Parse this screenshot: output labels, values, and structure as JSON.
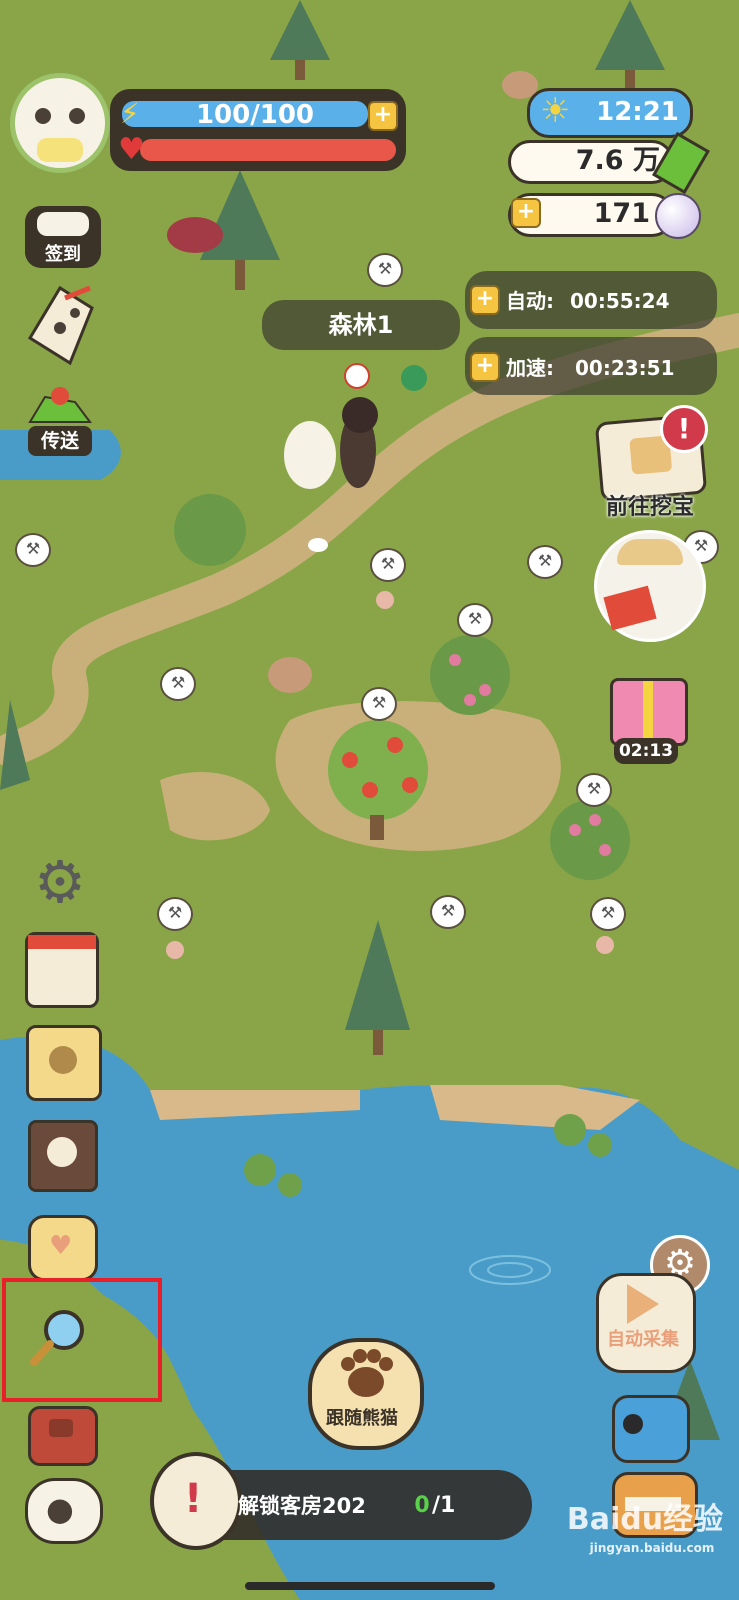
{
  "hud": {
    "energy": "100/100",
    "time": "12:21",
    "coins": "7.6 万",
    "pearls": "171"
  },
  "timers": {
    "auto_label": "自动:",
    "auto_time": "00:55:24",
    "speed_label": "加速:",
    "speed_time": "00:23:51"
  },
  "location": "森林1",
  "left_menu": {
    "signin": "签到",
    "teleport": "传送"
  },
  "right_menu": {
    "treasure": "前往挖宝",
    "gift_timer": "02:13",
    "auto_collect": "自动采集"
  },
  "bottom": {
    "follow": "跟随熊猫",
    "unlock_label": "解锁客房202",
    "progress_current": "0",
    "progress_total": "/1"
  },
  "watermark": "Baidu经验",
  "watermark_sub": "jingyan.baidu.com",
  "colors": {
    "grass": "#8aa547",
    "water": "#4a9cc8",
    "path": "#c9b07a",
    "energy_bar": "#5ab0e8",
    "health_bar": "#e9564a",
    "highlight_box": "#e8202a"
  }
}
